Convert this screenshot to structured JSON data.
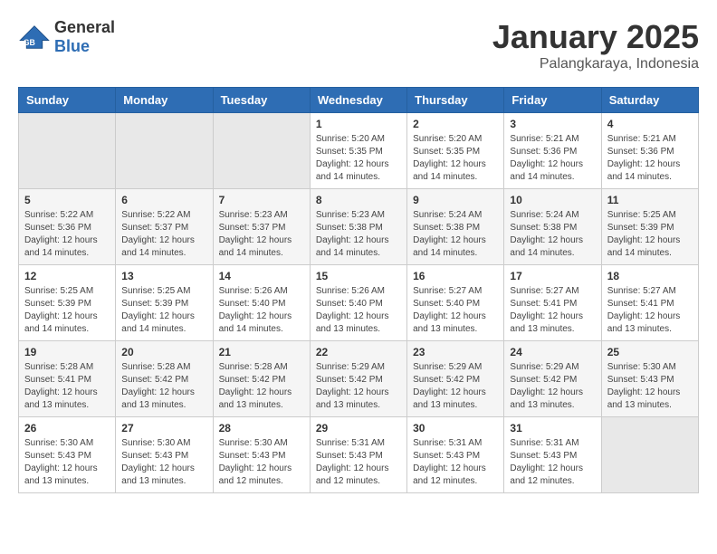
{
  "logo": {
    "general": "General",
    "blue": "Blue"
  },
  "header": {
    "month": "January 2025",
    "location": "Palangkaraya, Indonesia"
  },
  "weekdays": [
    "Sunday",
    "Monday",
    "Tuesday",
    "Wednesday",
    "Thursday",
    "Friday",
    "Saturday"
  ],
  "weeks": [
    [
      {
        "day": "",
        "sunrise": "",
        "sunset": "",
        "daylight": ""
      },
      {
        "day": "",
        "sunrise": "",
        "sunset": "",
        "daylight": ""
      },
      {
        "day": "",
        "sunrise": "",
        "sunset": "",
        "daylight": ""
      },
      {
        "day": "1",
        "sunrise": "Sunrise: 5:20 AM",
        "sunset": "Sunset: 5:35 PM",
        "daylight": "Daylight: 12 hours and 14 minutes."
      },
      {
        "day": "2",
        "sunrise": "Sunrise: 5:20 AM",
        "sunset": "Sunset: 5:35 PM",
        "daylight": "Daylight: 12 hours and 14 minutes."
      },
      {
        "day": "3",
        "sunrise": "Sunrise: 5:21 AM",
        "sunset": "Sunset: 5:36 PM",
        "daylight": "Daylight: 12 hours and 14 minutes."
      },
      {
        "day": "4",
        "sunrise": "Sunrise: 5:21 AM",
        "sunset": "Sunset: 5:36 PM",
        "daylight": "Daylight: 12 hours and 14 minutes."
      }
    ],
    [
      {
        "day": "5",
        "sunrise": "Sunrise: 5:22 AM",
        "sunset": "Sunset: 5:36 PM",
        "daylight": "Daylight: 12 hours and 14 minutes."
      },
      {
        "day": "6",
        "sunrise": "Sunrise: 5:22 AM",
        "sunset": "Sunset: 5:37 PM",
        "daylight": "Daylight: 12 hours and 14 minutes."
      },
      {
        "day": "7",
        "sunrise": "Sunrise: 5:23 AM",
        "sunset": "Sunset: 5:37 PM",
        "daylight": "Daylight: 12 hours and 14 minutes."
      },
      {
        "day": "8",
        "sunrise": "Sunrise: 5:23 AM",
        "sunset": "Sunset: 5:38 PM",
        "daylight": "Daylight: 12 hours and 14 minutes."
      },
      {
        "day": "9",
        "sunrise": "Sunrise: 5:24 AM",
        "sunset": "Sunset: 5:38 PM",
        "daylight": "Daylight: 12 hours and 14 minutes."
      },
      {
        "day": "10",
        "sunrise": "Sunrise: 5:24 AM",
        "sunset": "Sunset: 5:38 PM",
        "daylight": "Daylight: 12 hours and 14 minutes."
      },
      {
        "day": "11",
        "sunrise": "Sunrise: 5:25 AM",
        "sunset": "Sunset: 5:39 PM",
        "daylight": "Daylight: 12 hours and 14 minutes."
      }
    ],
    [
      {
        "day": "12",
        "sunrise": "Sunrise: 5:25 AM",
        "sunset": "Sunset: 5:39 PM",
        "daylight": "Daylight: 12 hours and 14 minutes."
      },
      {
        "day": "13",
        "sunrise": "Sunrise: 5:25 AM",
        "sunset": "Sunset: 5:39 PM",
        "daylight": "Daylight: 12 hours and 14 minutes."
      },
      {
        "day": "14",
        "sunrise": "Sunrise: 5:26 AM",
        "sunset": "Sunset: 5:40 PM",
        "daylight": "Daylight: 12 hours and 14 minutes."
      },
      {
        "day": "15",
        "sunrise": "Sunrise: 5:26 AM",
        "sunset": "Sunset: 5:40 PM",
        "daylight": "Daylight: 12 hours and 13 minutes."
      },
      {
        "day": "16",
        "sunrise": "Sunrise: 5:27 AM",
        "sunset": "Sunset: 5:40 PM",
        "daylight": "Daylight: 12 hours and 13 minutes."
      },
      {
        "day": "17",
        "sunrise": "Sunrise: 5:27 AM",
        "sunset": "Sunset: 5:41 PM",
        "daylight": "Daylight: 12 hours and 13 minutes."
      },
      {
        "day": "18",
        "sunrise": "Sunrise: 5:27 AM",
        "sunset": "Sunset: 5:41 PM",
        "daylight": "Daylight: 12 hours and 13 minutes."
      }
    ],
    [
      {
        "day": "19",
        "sunrise": "Sunrise: 5:28 AM",
        "sunset": "Sunset: 5:41 PM",
        "daylight": "Daylight: 12 hours and 13 minutes."
      },
      {
        "day": "20",
        "sunrise": "Sunrise: 5:28 AM",
        "sunset": "Sunset: 5:42 PM",
        "daylight": "Daylight: 12 hours and 13 minutes."
      },
      {
        "day": "21",
        "sunrise": "Sunrise: 5:28 AM",
        "sunset": "Sunset: 5:42 PM",
        "daylight": "Daylight: 12 hours and 13 minutes."
      },
      {
        "day": "22",
        "sunrise": "Sunrise: 5:29 AM",
        "sunset": "Sunset: 5:42 PM",
        "daylight": "Daylight: 12 hours and 13 minutes."
      },
      {
        "day": "23",
        "sunrise": "Sunrise: 5:29 AM",
        "sunset": "Sunset: 5:42 PM",
        "daylight": "Daylight: 12 hours and 13 minutes."
      },
      {
        "day": "24",
        "sunrise": "Sunrise: 5:29 AM",
        "sunset": "Sunset: 5:42 PM",
        "daylight": "Daylight: 12 hours and 13 minutes."
      },
      {
        "day": "25",
        "sunrise": "Sunrise: 5:30 AM",
        "sunset": "Sunset: 5:43 PM",
        "daylight": "Daylight: 12 hours and 13 minutes."
      }
    ],
    [
      {
        "day": "26",
        "sunrise": "Sunrise: 5:30 AM",
        "sunset": "Sunset: 5:43 PM",
        "daylight": "Daylight: 12 hours and 13 minutes."
      },
      {
        "day": "27",
        "sunrise": "Sunrise: 5:30 AM",
        "sunset": "Sunset: 5:43 PM",
        "daylight": "Daylight: 12 hours and 13 minutes."
      },
      {
        "day": "28",
        "sunrise": "Sunrise: 5:30 AM",
        "sunset": "Sunset: 5:43 PM",
        "daylight": "Daylight: 12 hours and 12 minutes."
      },
      {
        "day": "29",
        "sunrise": "Sunrise: 5:31 AM",
        "sunset": "Sunset: 5:43 PM",
        "daylight": "Daylight: 12 hours and 12 minutes."
      },
      {
        "day": "30",
        "sunrise": "Sunrise: 5:31 AM",
        "sunset": "Sunset: 5:43 PM",
        "daylight": "Daylight: 12 hours and 12 minutes."
      },
      {
        "day": "31",
        "sunrise": "Sunrise: 5:31 AM",
        "sunset": "Sunset: 5:43 PM",
        "daylight": "Daylight: 12 hours and 12 minutes."
      },
      {
        "day": "",
        "sunrise": "",
        "sunset": "",
        "daylight": ""
      }
    ]
  ]
}
